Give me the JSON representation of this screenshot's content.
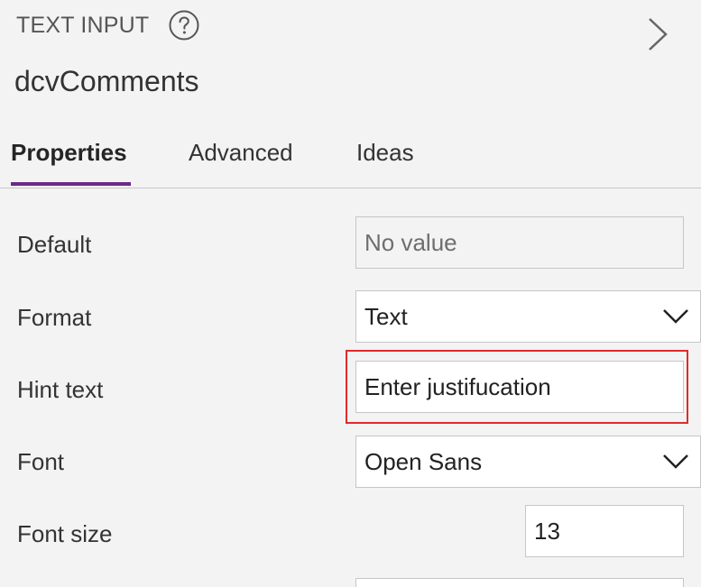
{
  "header": {
    "control_type": "TEXT INPUT",
    "help_icon": "question-circle-icon",
    "expand_icon": "chevron-right-icon",
    "control_name": "dcvComments"
  },
  "tabs": [
    {
      "label": "Properties",
      "active": true
    },
    {
      "label": "Advanced",
      "active": false
    },
    {
      "label": "Ideas",
      "active": false
    }
  ],
  "accent_color": "#6b2a86",
  "highlight_color": "#e02a2a",
  "properties": [
    {
      "label": "Default",
      "value": "No value",
      "kind": "readonly-text"
    },
    {
      "label": "Format",
      "value": "Text",
      "kind": "dropdown"
    },
    {
      "label": "Hint text",
      "value": "Enter justifucation",
      "kind": "text",
      "highlighted": true
    },
    {
      "label": "Font",
      "value": "Open Sans",
      "kind": "dropdown"
    },
    {
      "label": "Font size",
      "value": "13",
      "kind": "number"
    }
  ]
}
